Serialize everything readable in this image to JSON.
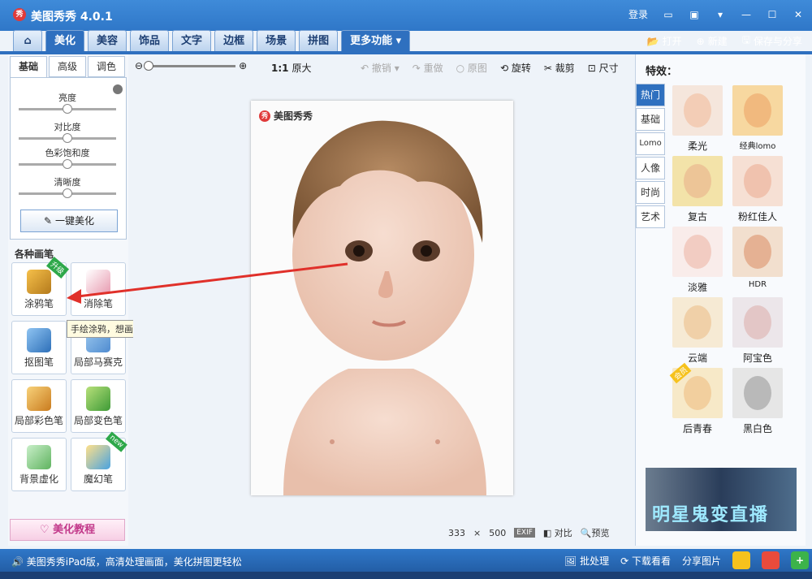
{
  "app": {
    "logo": "秀",
    "title": "美图秀秀 4.0.1",
    "login": "登录"
  },
  "main_tabs": [
    "美化",
    "美容",
    "饰品",
    "文字",
    "边框",
    "场景",
    "拼图",
    "更多功能"
  ],
  "actions": {
    "open": "打开",
    "new": "新建",
    "save_share": "保存与分享"
  },
  "left": {
    "subtabs": [
      "基础",
      "高级",
      "调色"
    ],
    "sliders": [
      {
        "label": "亮度",
        "value": 0.5
      },
      {
        "label": "对比度",
        "value": 0.5
      },
      {
        "label": "色彩饱和度",
        "value": 0.5
      },
      {
        "label": "清晰度",
        "value": 0.5
      }
    ],
    "one_key": "一键美化",
    "brush_title": "各种画笔",
    "brushes": [
      "涂鸦笔",
      "消除笔",
      "抠图笔",
      "局部马赛克",
      "局部彩色笔",
      "局部变色笔",
      "背景虚化",
      "魔幻笔"
    ],
    "badge_upgrade": "升级",
    "badge_new": "new",
    "tooltip": "手绘涂鸦，想画就画",
    "tutorial": "美化教程"
  },
  "canvas_toolbar": {
    "ratio_icon": "1:1",
    "ratio": "原大",
    "undo": "撤销",
    "redo": "重做",
    "original": "原图",
    "rotate": "旋转",
    "crop": "裁剪",
    "size": "尺寸"
  },
  "photo": {
    "watermark": "美图秀秀",
    "watermark_logo": "秀",
    "width": "333",
    "times": "×",
    "height": "500",
    "exif": "EXIF",
    "compare": "对比",
    "preview": "预览"
  },
  "right": {
    "title": "特效：",
    "categories": [
      "热门",
      "基础",
      "Lomo",
      "人像",
      "时尚",
      "艺术"
    ],
    "effects": [
      "柔光",
      "经典lomo",
      "复古",
      "粉红佳人",
      "淡雅",
      "HDR",
      "云端",
      "阿宝色",
      "后青春",
      "黑白色"
    ],
    "vip": "会员",
    "ad_text": "明星鬼变直播"
  },
  "status": {
    "message": "美图秀秀iPad版，高清处理画面，美化拼图更轻松",
    "batch": "批处理",
    "download": "下载看看",
    "share": "分享图片"
  },
  "colors": {
    "accent": "#2f70bf",
    "titlebar": "#3f8bd9",
    "arrow": "#e0302a"
  }
}
